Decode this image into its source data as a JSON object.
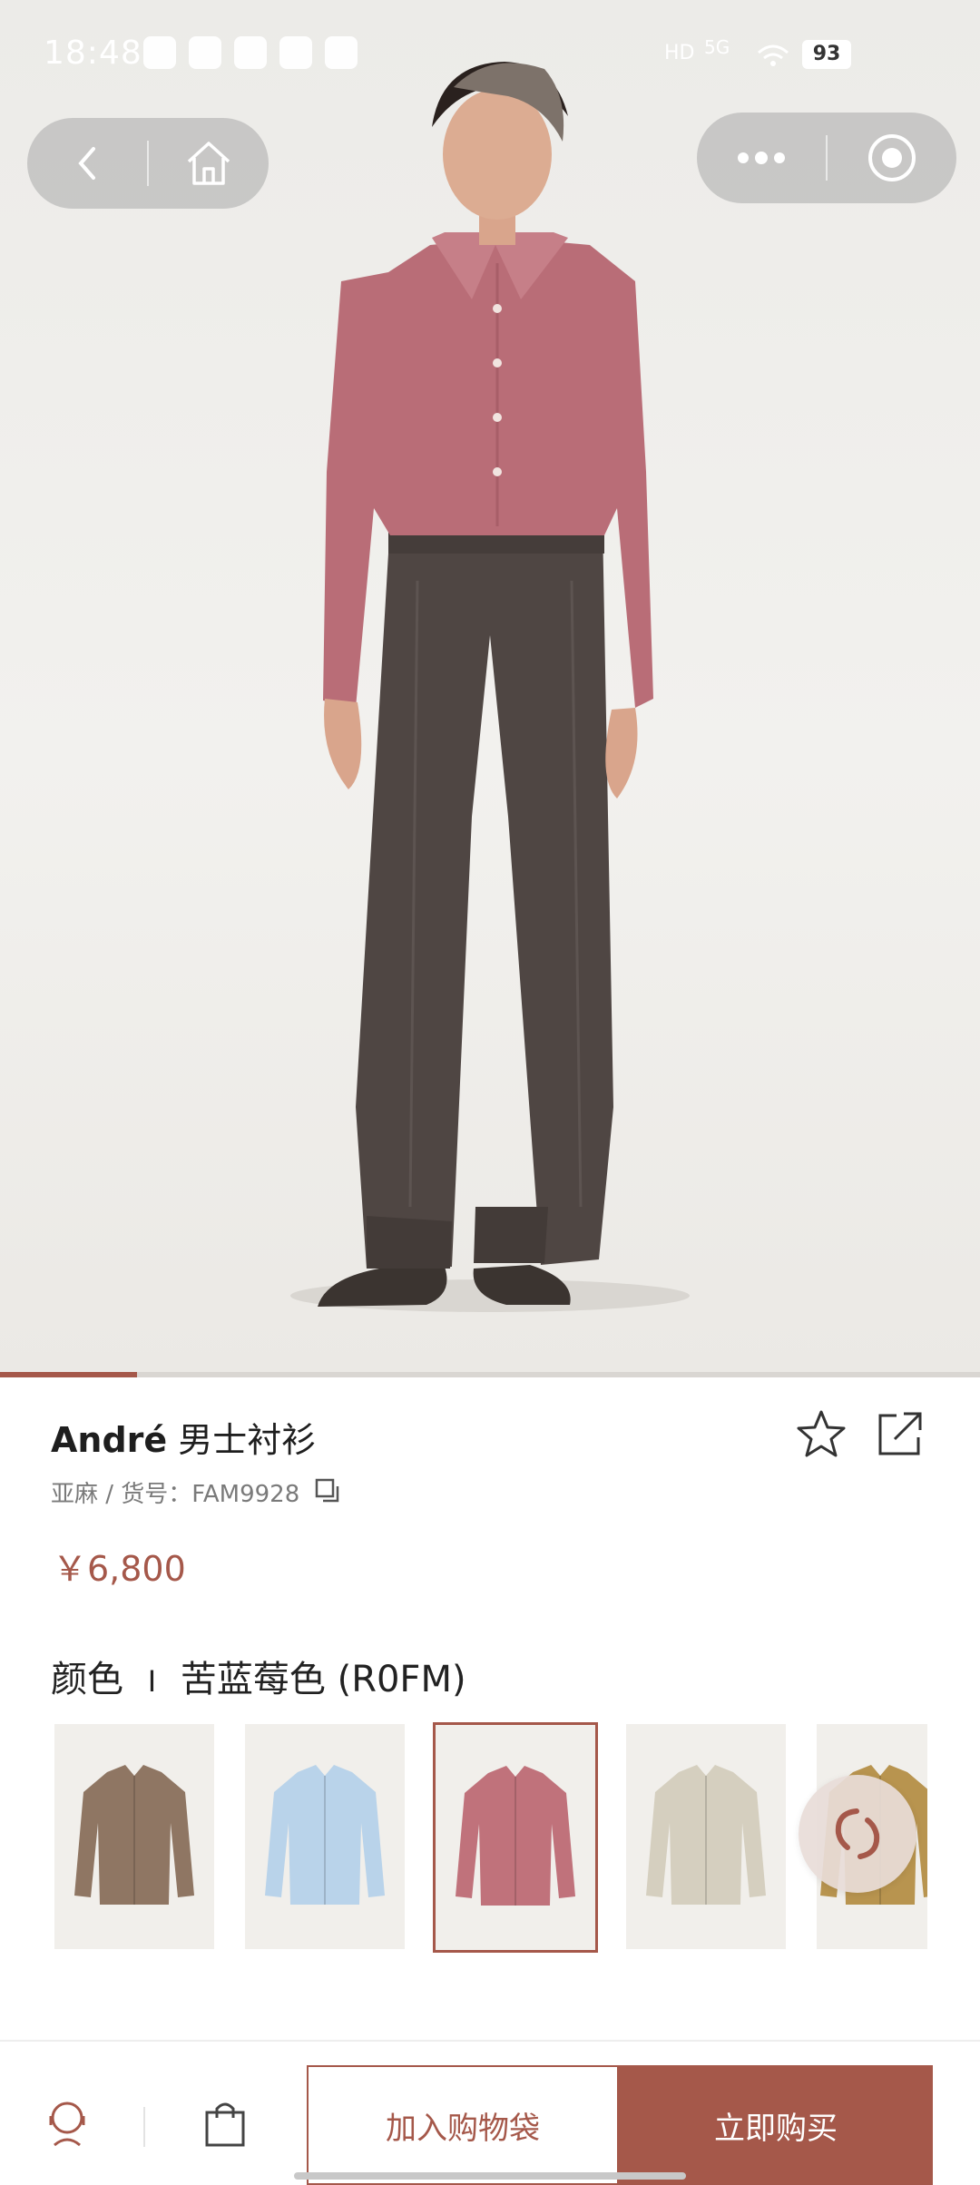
{
  "status_bar": {
    "time": "18:48",
    "network": "5G",
    "hd": "HD",
    "battery": "93"
  },
  "gallery": {
    "image_description_icon": "model-photo",
    "progress_fraction": 0.14
  },
  "product": {
    "name_en": "André",
    "name_cn": "男士衬衫",
    "material_sku_label": "亚麻 / 货号：",
    "sku": "FAM9928",
    "price": "￥6,800"
  },
  "color": {
    "label": "颜色",
    "separator": "I",
    "selected": "苦蓝莓色 (R0FM)",
    "swatches": [
      {
        "shirt_color": "#8f7663",
        "selected": false
      },
      {
        "shirt_color": "#b9d3ea",
        "selected": false
      },
      {
        "shirt_color": "#c0727b",
        "selected": true
      },
      {
        "shirt_color": "#d5cfbf",
        "selected": false
      },
      {
        "shirt_color": "#b8944f",
        "selected": false
      }
    ]
  },
  "actions": {
    "add_to_bag": "加入购物袋",
    "buy_now": "立即购买"
  },
  "colors": {
    "accent": "#a5584a"
  }
}
